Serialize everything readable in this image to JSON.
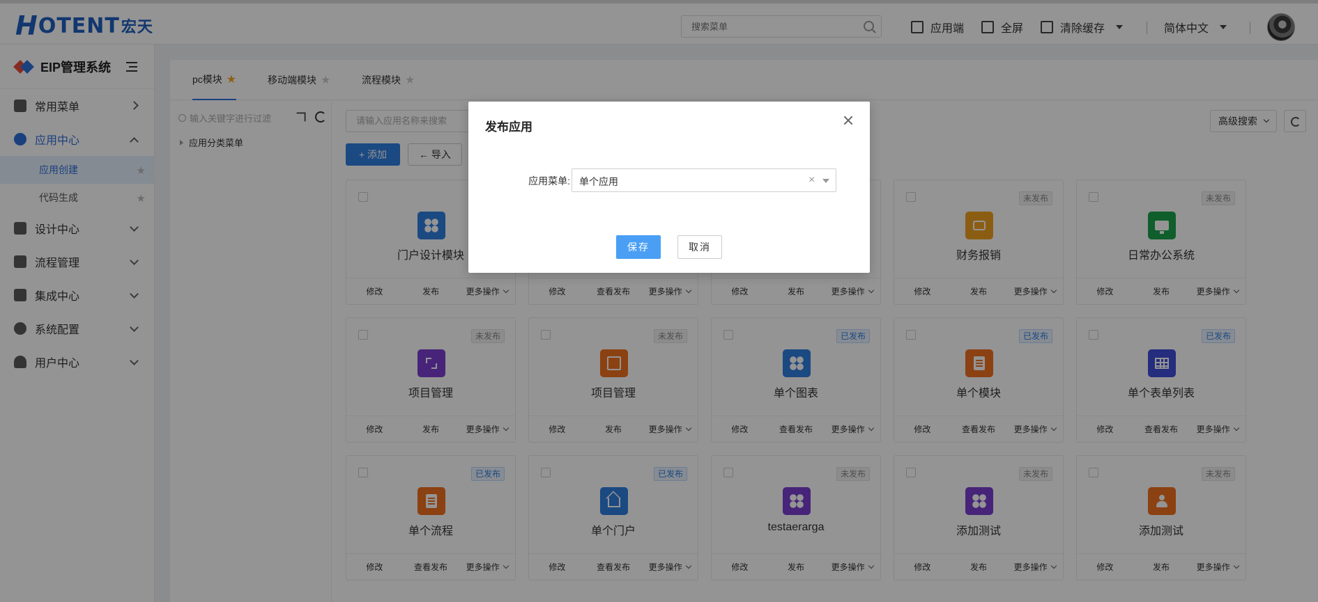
{
  "header": {
    "logo_text": "OTENT",
    "logo_h": "H",
    "logo_cn": "宏天",
    "search_placeholder": "搜索菜单",
    "app_end": "应用端",
    "fullscreen": "全屏",
    "clear_cache": "清除缓存",
    "language": "简体中文"
  },
  "sidebar": {
    "system_name": "EIP管理系统",
    "items": [
      {
        "label": "常用菜单"
      },
      {
        "label": "应用中心"
      },
      {
        "label": "设计中心"
      },
      {
        "label": "流程管理"
      },
      {
        "label": "集成中心"
      },
      {
        "label": "系统配置"
      },
      {
        "label": "用户中心"
      }
    ],
    "subitems": [
      {
        "label": "应用创建"
      },
      {
        "label": "代码生成"
      }
    ]
  },
  "tabs": [
    {
      "label": "pc模块"
    },
    {
      "label": "移动端模块"
    },
    {
      "label": "流程模块"
    }
  ],
  "tree": {
    "search_placeholder": "输入关键字进行过滤",
    "root_node": "应用分类菜单"
  },
  "toolbar": {
    "search_placeholder": "请输入应用名称来搜索",
    "add_label": "+ 添加",
    "import_label": "← 导入",
    "advanced_search": "高级搜索"
  },
  "cards": [
    {
      "name": "门户设计模块",
      "status": "",
      "actions": [
        "修改",
        "发布",
        "更多操作"
      ],
      "color": "#2f7fe0",
      "icon": "clover-icon"
    },
    {
      "name": "",
      "status": "",
      "actions": [
        "修改",
        "查看发布",
        "更多操作"
      ],
      "color": "#2f7fe0",
      "icon": "clover-icon"
    },
    {
      "name": "",
      "status": "",
      "actions": [
        "修改",
        "发布",
        "更多操作"
      ],
      "color": "#2f7fe0",
      "icon": "clover-icon"
    },
    {
      "name": "财务报销",
      "status": "未发布",
      "actions": [
        "修改",
        "发布",
        "更多操作"
      ],
      "color": "#f0a020",
      "icon": "cycle-icon"
    },
    {
      "name": "日常办公系统",
      "status": "未发布",
      "actions": [
        "修改",
        "发布",
        "更多操作"
      ],
      "color": "#1aa34a",
      "icon": "screen-icon"
    },
    {
      "name": "项目管理",
      "status": "未发布",
      "actions": [
        "修改",
        "发布",
        "更多操作"
      ],
      "color": "#7a3fd1",
      "icon": "expand-icon"
    },
    {
      "name": "项目管理",
      "status": "未发布",
      "actions": [
        "修改",
        "发布",
        "更多操作"
      ],
      "color": "#f07020",
      "icon": "box-icon"
    },
    {
      "name": "单个图表",
      "status": "已发布",
      "actions": [
        "修改",
        "查看发布",
        "更多操作"
      ],
      "color": "#2f7fe0",
      "icon": "clover-icon"
    },
    {
      "name": "单个模块",
      "status": "已发布",
      "actions": [
        "修改",
        "查看发布",
        "更多操作"
      ],
      "color": "#f07020",
      "icon": "doc-icon"
    },
    {
      "name": "单个表单列表",
      "status": "已发布",
      "actions": [
        "修改",
        "查看发布",
        "更多操作"
      ],
      "color": "#3f4fd9",
      "icon": "grid-icon"
    },
    {
      "name": "单个流程",
      "status": "已发布",
      "actions": [
        "修改",
        "查看发布",
        "更多操作"
      ],
      "color": "#f07020",
      "icon": "doc-icon"
    },
    {
      "name": "单个门户",
      "status": "已发布",
      "actions": [
        "修改",
        "查看发布",
        "更多操作"
      ],
      "color": "#2f7fe0",
      "icon": "house-icon"
    },
    {
      "name": "testaerarga",
      "status": "未发布",
      "actions": [
        "修改",
        "发布",
        "更多操作"
      ],
      "color": "#7a3fd1",
      "icon": "clover-icon"
    },
    {
      "name": "添加测试",
      "status": "未发布",
      "actions": [
        "修改",
        "发布",
        "更多操作"
      ],
      "color": "#7a3fd1",
      "icon": "clover-icon"
    },
    {
      "name": "添加测试",
      "status": "未发布",
      "actions": [
        "修改",
        "发布",
        "更多操作"
      ],
      "color": "#f07020",
      "icon": "person-icon"
    }
  ],
  "modal": {
    "title": "发布应用",
    "field_label": "应用菜单:",
    "field_value": "单个应用",
    "save": "保存",
    "cancel": "取消"
  }
}
